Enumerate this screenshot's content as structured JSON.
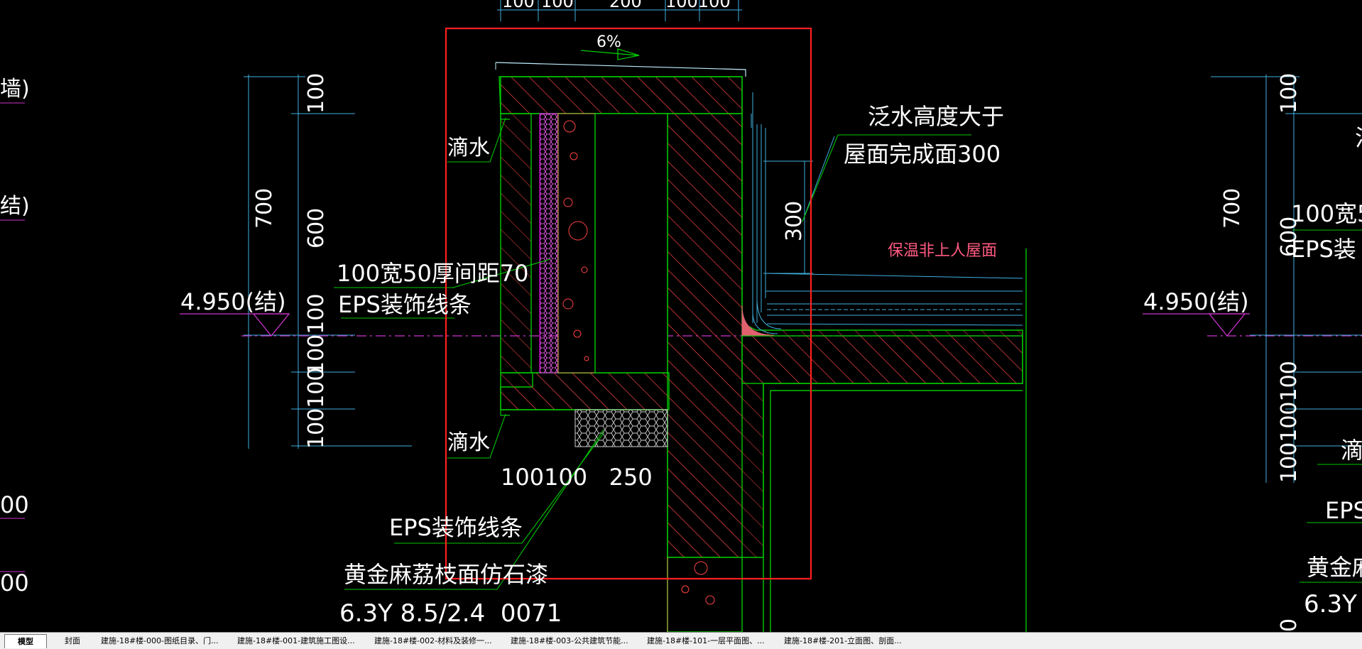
{
  "drawing": {
    "dims_top": [
      "100",
      "100",
      "200",
      "100100"
    ],
    "slope": "6%",
    "left_dims": [
      "100",
      "700",
      "600",
      "100100",
      "100100"
    ],
    "elev_left": "4.950(结)",
    "elev_right": "4.950(结)",
    "drip_label_1": "滴水",
    "drip_label_2": "滴水",
    "eps_strip_line1": "100宽50厚间距70",
    "eps_strip_line2": "EPS装饰线条",
    "bottom_dims": "100100   250",
    "eps_label": "EPS装饰线条",
    "paint_label": "黄金麻荔枝面仿石漆",
    "paint_code": "6.3Y 8.5/2.4  0071",
    "flash_note_line1": "泛水高度大于",
    "flash_note_line2": "屋面完成面300",
    "dim_300": "300",
    "roof_label": "保温非上人屋面",
    "far_left_1": "墙)",
    "far_left_2": "结)",
    "far_left_3": "00",
    "far_left_4": "00",
    "right_dims": [
      "100",
      "700",
      "600",
      "100100100"
    ],
    "right_strip_1": "100宽5",
    "right_strip_2": "EPS装",
    "right_drip": "滴",
    "right_eps": "EPS",
    "right_paint": "黄金麻",
    "right_code": "6.3Y",
    "right_bottom": "0",
    "right_top_char": "泛"
  },
  "layout_tabs": [
    {
      "label": "模型",
      "active": true
    },
    {
      "label": "封面",
      "active": false
    },
    {
      "label": "建施-18#楼-000-图纸目录、门...",
      "active": false
    },
    {
      "label": "建施-18#楼-001-建筑施工图设...",
      "active": false
    },
    {
      "label": "建施-18#楼-002-材料及装修一...",
      "active": false
    },
    {
      "label": "建施-18#楼-003-公共建筑节能...",
      "active": false
    },
    {
      "label": "建施-18#楼-101-一层平面图、...",
      "active": false
    },
    {
      "label": "建施-18#楼-201-立面图、剖面...",
      "active": false
    }
  ],
  "colors": {
    "background": "#000000",
    "concrete_outline": "#00c800",
    "dimension": "#3fb0e0",
    "text": "#ffffff",
    "highlight_box": "#ff2020",
    "insulation": "#ff00ff",
    "roof_label": "#ff5a80",
    "elevation_line": "#cc33cc"
  }
}
